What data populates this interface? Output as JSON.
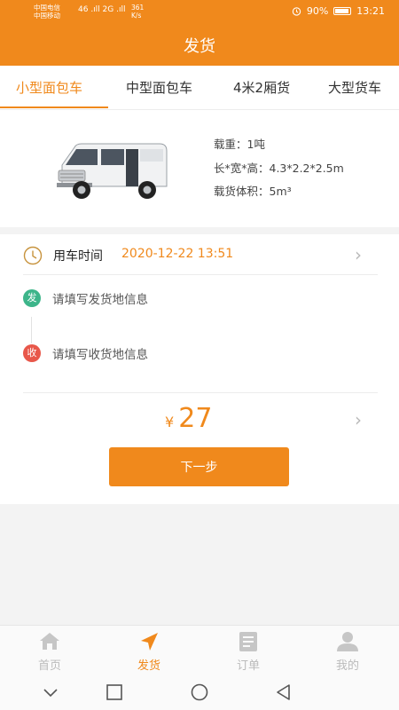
{
  "status_bar": {
    "carrier1": "中国电信",
    "carrier2": "中国移动",
    "signal": "46 .ıll 2G .ıll",
    "speed_value": "361",
    "speed_unit": "K/s",
    "battery": "90%",
    "time": "13:21"
  },
  "header": {
    "title": "发货"
  },
  "tabs": [
    {
      "label": "小型面包车",
      "active": true
    },
    {
      "label": "中型面包车",
      "active": false
    },
    {
      "label": "4米2厢货",
      "active": false
    },
    {
      "label": "大型货车",
      "active": false
    }
  ],
  "vehicle": {
    "load": "载重：1吨",
    "dims": "长*宽*高：4.3*2.2*2.5m",
    "volume": "载货体积：5m³"
  },
  "form": {
    "time_label": "用车时间",
    "time_value": "2020-12-22 13:51",
    "send_badge": "发",
    "send_placeholder": "请填写发货地信息",
    "recv_badge": "收",
    "recv_placeholder": "请填写收货地信息",
    "currency": "¥",
    "price": "27",
    "next_label": "下一步"
  },
  "bottom_nav": [
    {
      "label": "首页",
      "icon": "home-icon"
    },
    {
      "label": "发货",
      "icon": "navigation-arrow-icon",
      "active": true
    },
    {
      "label": "订单",
      "icon": "document-icon"
    },
    {
      "label": "我的",
      "icon": "user-icon"
    }
  ],
  "colors": {
    "accent": "#f0891c",
    "send": "#3db58a",
    "receive": "#e8574a"
  }
}
